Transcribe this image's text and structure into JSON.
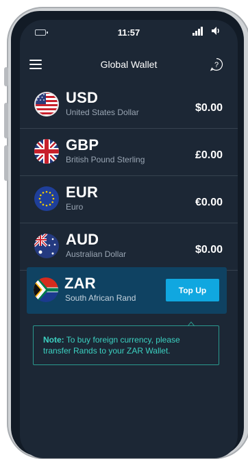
{
  "status_bar": {
    "time": "11:57",
    "icons": [
      "battery-icon",
      "signal-icon",
      "volume-icon"
    ]
  },
  "header": {
    "title": "Global Wallet",
    "menu_icon": "hamburger-menu-icon",
    "help_icon": "help-question-icon"
  },
  "wallets": [
    {
      "code": "USD",
      "name": "United States Dollar",
      "amount": "$0.00",
      "flag_icon": "us-flag-icon"
    },
    {
      "code": "GBP",
      "name": "British Pound Sterling",
      "amount": "£0.00",
      "flag_icon": "uk-flag-icon"
    },
    {
      "code": "EUR",
      "name": "Euro",
      "amount": "€0.00",
      "flag_icon": "eu-flag-icon"
    },
    {
      "code": "AUD",
      "name": "Australian Dollar",
      "amount": "$0.00",
      "flag_icon": "au-flag-icon"
    }
  ],
  "zar_wallet": {
    "code": "ZAR",
    "name": "South African Rand",
    "button_label": "Top Up",
    "flag_icon": "za-flag-icon"
  },
  "note": {
    "label": "Note:",
    "text": "To buy foreign currency, please transfer Rands to your ZAR Wallet."
  },
  "colors": {
    "background": "#1c2735",
    "highlight_row": "#0f4262",
    "button": "#10a7e0",
    "note_text": "#3cd2c2",
    "note_border": "#2b9a8f"
  }
}
